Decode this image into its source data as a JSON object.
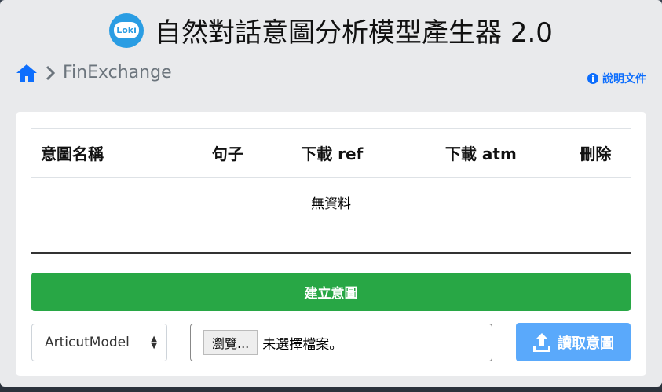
{
  "header": {
    "title": "自然對話意圖分析模型產生器 2.0",
    "logo_text": "Loki"
  },
  "breadcrumb": {
    "home_icon": "home-icon",
    "project": "FinExchange"
  },
  "help": {
    "label": "說明文件",
    "icon": "info-icon"
  },
  "table": {
    "columns": [
      "意圖名稱",
      "句子",
      "下載 ref",
      "下載 atm",
      "刪除"
    ],
    "empty_text": "無資料"
  },
  "create_button": "建立意圖",
  "model_select": {
    "value": "ArticutModel"
  },
  "file_input": {
    "browse_label": "瀏覽...",
    "status": "未選擇檔案。"
  },
  "upload_button": "讀取意圖",
  "colors": {
    "create": "#28a745",
    "upload": "#5aa9fb",
    "link": "#0d6efd"
  }
}
